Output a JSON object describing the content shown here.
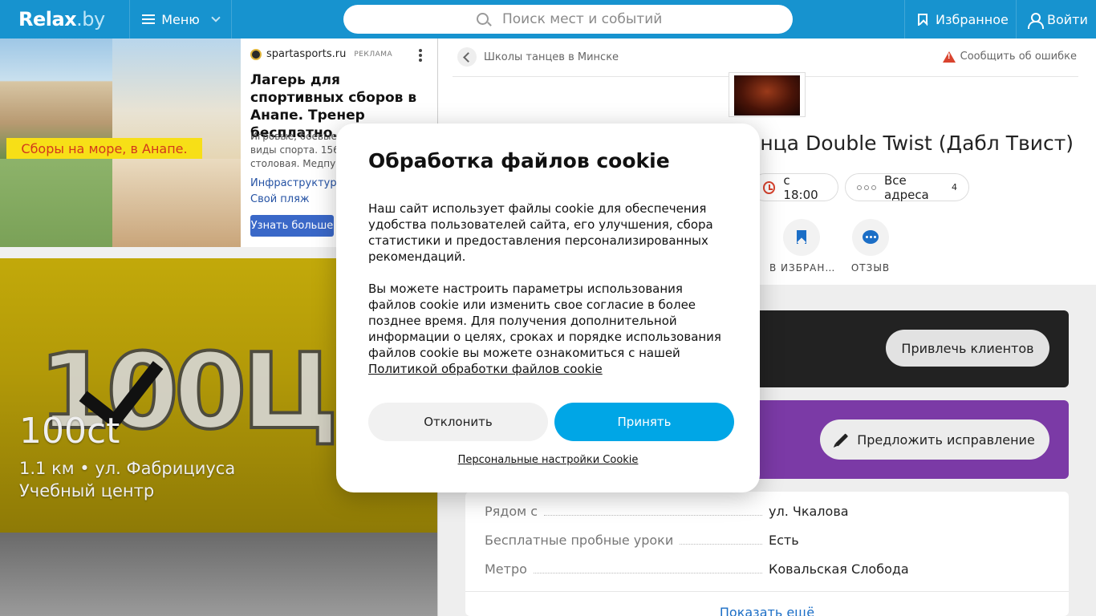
{
  "header": {
    "logo": "Relax",
    "logo_suffix": ".by",
    "menu_label": "Меню",
    "search_placeholder": "Поиск мест и событий",
    "favorites_label": "Избранное",
    "login_label": "Войти",
    "accent_color": "#1793cf"
  },
  "ad": {
    "banner_text": "Сборы на море, в Анапе.",
    "source": "spartasports.ru",
    "label": "РЕКЛАМА",
    "title": "Лагерь для спортивных сборов в Анапе. Тренер бесплатно.",
    "description_lines": [
      "Игровые, боевые,",
      "виды спорта. 156 к",
      "столовая. Медпун"
    ],
    "links": [
      "Инфраструктура с",
      "Свой пляж"
    ],
    "cta": "Узнать больше"
  },
  "venue_card": {
    "logo_text": "100Ц",
    "name": "100ct",
    "address": "1.1 км • ул. Фабрициуса",
    "type": "Учебный центр"
  },
  "detail": {
    "breadcrumb": "Школы танцев в Минске",
    "report_label": "Сообщить об ошибке",
    "title": "анца Double Twist (Дабл Твист)",
    "time_chip": "с 18:00",
    "address_chip": "Все адреса",
    "address_count": "4",
    "actions": [
      {
        "label": "В ИЗБРАН…",
        "icon": "bookmark-icon"
      },
      {
        "label": "ОТЗЫВ",
        "icon": "chat-icon"
      }
    ],
    "attract_button": "Привлечь клиентов",
    "suggest_button": "Предложить исправление",
    "info_rows": [
      {
        "key": "Рядом с",
        "value": "ул. Чкалова"
      },
      {
        "key": "Бесплатные пробные уроки",
        "value": "Есть"
      },
      {
        "key": "Метро",
        "value": "Ковальская Слобода"
      }
    ],
    "show_more": "Показать ещё",
    "purple_color": "#7b3aa6"
  },
  "cookie_modal": {
    "title": "Обработка файлов cookie",
    "paragraph_1": "Наш сайт использует файлы cookie для обеспечения удобства пользователей сайта, его улучшения, сбора статистики и предоставления персонализированных рекомендаций.",
    "paragraph_2": "Вы можете настроить параметры использования файлов cookie или изменить свое согласие в более позднее время. Для получения дополнительной информации о целях, сроках и порядке использования файлов cookie вы можете ознакомиться с нашей",
    "policy_link": "Политикой обработки файлов cookie",
    "decline_button": "Отклонить",
    "accept_button": "Принять",
    "settings_link": "Персональные настройки Cookie",
    "accept_color": "#00a6e6"
  }
}
